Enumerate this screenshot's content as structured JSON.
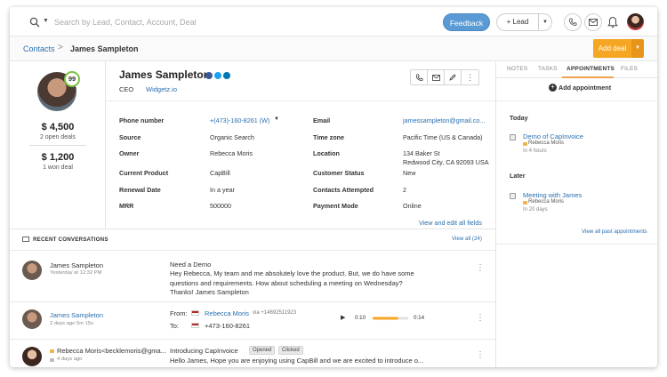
{
  "topbar": {
    "search_placeholder": "Search by Lead, Contact, Account, Deal",
    "feedback_label": "Feedback",
    "lead_label": "+ Lead"
  },
  "breadcrumb": {
    "parent": "Contacts",
    "separator": ">",
    "current": "James Sampleton"
  },
  "add_deal_label": "Add deal",
  "profile": {
    "score": "99",
    "open_amount": "$ 4,500",
    "open_label": "2 open deals",
    "won_amount": "$ 1,200",
    "won_label": "1 won deal",
    "name": "James Sampleton",
    "role": "CEO",
    "company": "Widgetz.io"
  },
  "fields_left": [
    {
      "label": "Phone number",
      "value": "+(473)-160-8261 (W)"
    },
    {
      "label": "Source",
      "value": "Organic Search"
    },
    {
      "label": "Owner",
      "value": "Rebecca Moris"
    },
    {
      "label": "Current Product",
      "value": "CapBill"
    },
    {
      "label": "Renewal Date",
      "value": "In a year"
    },
    {
      "label": "MRR",
      "value": "500000"
    }
  ],
  "fields_right": [
    {
      "label": "Email",
      "value": "jamessampleton@gmail.co..."
    },
    {
      "label": "Time zone",
      "value": "Pacific Time (US & Canada)"
    },
    {
      "label": "Location",
      "value": "134 Baker St",
      "value2": "Redwood City, CA 92093 USA"
    },
    {
      "label": "Customer Status",
      "value": "New"
    },
    {
      "label": "Contacts Attempted",
      "value": "2"
    },
    {
      "label": "Payment Mode",
      "value": "Online"
    }
  ],
  "view_edit_all": "View and edit all fields",
  "panel": {
    "tabs": [
      "NOTES",
      "TASKS",
      "APPOINTMENTS",
      "FILES"
    ],
    "active_tab": "APPOINTMENTS",
    "add_appointment": "Add appointment",
    "today_label": "Today",
    "today_items": [
      {
        "title": "Demo of CapInvoice",
        "who": "Rebecca Moris",
        "when": "In 4 hours"
      }
    ],
    "later_label": "Later",
    "later_items": [
      {
        "title": "Meeting with James",
        "who": "Rebecca Moris",
        "when": "In 20 days"
      }
    ],
    "view_past": "View all past appointments"
  },
  "conversations": {
    "title": "RECENT CONVERSATIONS",
    "view_all": "View all (24)",
    "items": [
      {
        "name": "James Sampleton",
        "meta": "Yesterday at 12:32 PM",
        "subject": "Need a Demo",
        "body": "Hey Rebecca, My team and me absolutely love the product. But, we do have some questions and requirements. How about scheduling a meeting on Wednesday? Thanks! James Sampleton"
      },
      {
        "name": "James Sampleton",
        "meta": "2 days ago 5m 15s",
        "from_label": "From:",
        "from_name": "Rebecca Moris",
        "from_via": "via +14692511923",
        "to_label": "To:",
        "to_number": "+473-160-8261",
        "time_start": "0:10",
        "time_end": "0:14",
        "audio_progress": 0.72
      },
      {
        "name": "Rebecca Moris<becklemoris@gma...",
        "meta": "4 days ago",
        "subject": "Introducing CapInvoice",
        "badges": [
          "Opened",
          "Clicked"
        ],
        "body": "Hello James, Hope you are enjoying using CapBill and we are excited to introduce o..."
      }
    ]
  },
  "colors": {
    "link": "#2a6fb0",
    "accent_orange": "#f5a623",
    "feedback_blue": "#5b9bd5",
    "score_green": "#7cc142"
  }
}
